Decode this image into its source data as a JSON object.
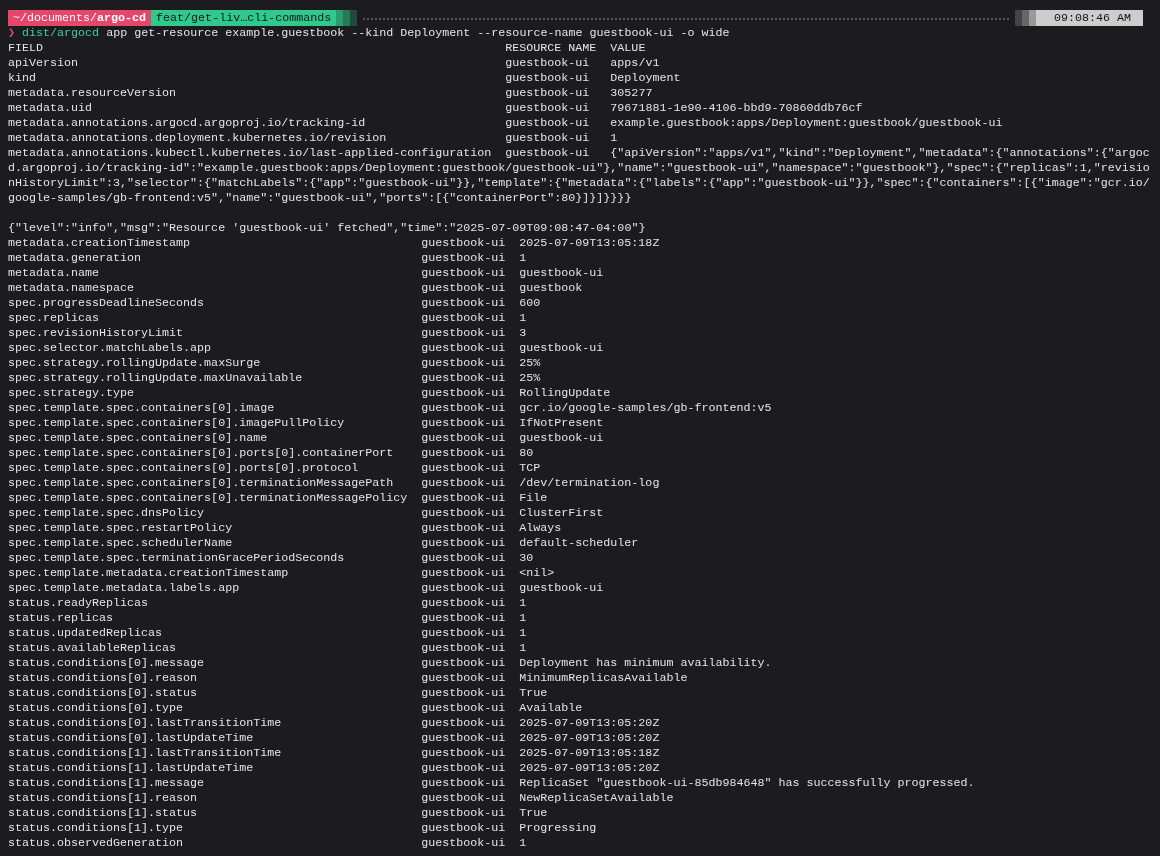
{
  "status_line": {
    "path": "~/documents/**argo-cd**",
    "branch": "feat/get-liv…cli-commands",
    "time": "09:08:46 AM"
  },
  "command": {
    "prompt": "❯",
    "program": "dist/argocd",
    "args": "app get-resource example.guestbook --kind Deployment --resource-name guestbook-ui -o wide"
  },
  "table_1": {
    "columns": [
      "FIELD",
      "RESOURCE NAME",
      "VALUE"
    ],
    "rows": [
      {
        "field": "apiVersion",
        "resource": "guestbook-ui",
        "value": "apps/v1"
      },
      {
        "field": "kind",
        "resource": "guestbook-ui",
        "value": "Deployment"
      },
      {
        "field": "metadata.resourceVersion",
        "resource": "guestbook-ui",
        "value": "305277"
      },
      {
        "field": "metadata.uid",
        "resource": "guestbook-ui",
        "value": "79671881-1e90-4106-bbd9-70860ddb76cf"
      },
      {
        "field": "metadata.annotations.argocd.argoproj.io/tracking-id",
        "resource": "guestbook-ui",
        "value": "example.guestbook:apps/Deployment:guestbook/guestbook-ui"
      },
      {
        "field": "metadata.annotations.deployment.kubernetes.io/revision",
        "resource": "guestbook-ui",
        "value": "1"
      },
      {
        "field": "metadata.annotations.kubectl.kubernetes.io/last-applied-configuration",
        "resource": "guestbook-ui",
        "value": "{\"apiVersion\":\"apps/v1\",\"kind\":\"Deployment\",\"metadata\":{\"annotations\":{\"argocd.argoproj.io/tracking-id\":\"example.guestbook:apps/Deployment:guestbook/guestbook-ui\"},\"name\":\"guestbook-ui\",\"namespace\":\"guestbook\"},\"spec\":{\"replicas\":1,\"revisionHistoryLimit\":3,\"selector\":{\"matchLabels\":{\"app\":\"guestbook-ui\"}},\"template\":{\"metadata\":{\"labels\":{\"app\":\"guestbook-ui\"}},\"spec\":{\"containers\":[{\"image\":\"gcr.io/google-samples/gb-frontend:v5\",\"name\":\"guestbook-ui\",\"ports\":[{\"containerPort\":80}]}]}}}}"
      }
    ]
  },
  "log": "{\"level\":\"info\",\"msg\":\"Resource 'guestbook-ui' fetched\",\"time\":\"2025-07-09T09:08:47-04:00\"}",
  "table_2": {
    "rows": [
      {
        "field": "metadata.creationTimestamp",
        "resource": "guestbook-ui",
        "value": "2025-07-09T13:05:18Z"
      },
      {
        "field": "metadata.generation",
        "resource": "guestbook-ui",
        "value": "1"
      },
      {
        "field": "metadata.name",
        "resource": "guestbook-ui",
        "value": "guestbook-ui"
      },
      {
        "field": "metadata.namespace",
        "resource": "guestbook-ui",
        "value": "guestbook"
      },
      {
        "field": "spec.progressDeadlineSeconds",
        "resource": "guestbook-ui",
        "value": "600"
      },
      {
        "field": "spec.replicas",
        "resource": "guestbook-ui",
        "value": "1"
      },
      {
        "field": "spec.revisionHistoryLimit",
        "resource": "guestbook-ui",
        "value": "3"
      },
      {
        "field": "spec.selector.matchLabels.app",
        "resource": "guestbook-ui",
        "value": "guestbook-ui"
      },
      {
        "field": "spec.strategy.rollingUpdate.maxSurge",
        "resource": "guestbook-ui",
        "value": "25%"
      },
      {
        "field": "spec.strategy.rollingUpdate.maxUnavailable",
        "resource": "guestbook-ui",
        "value": "25%"
      },
      {
        "field": "spec.strategy.type",
        "resource": "guestbook-ui",
        "value": "RollingUpdate"
      },
      {
        "field": "spec.template.spec.containers[0].image",
        "resource": "guestbook-ui",
        "value": "gcr.io/google-samples/gb-frontend:v5"
      },
      {
        "field": "spec.template.spec.containers[0].imagePullPolicy",
        "resource": "guestbook-ui",
        "value": "IfNotPresent"
      },
      {
        "field": "spec.template.spec.containers[0].name",
        "resource": "guestbook-ui",
        "value": "guestbook-ui"
      },
      {
        "field": "spec.template.spec.containers[0].ports[0].containerPort",
        "resource": "guestbook-ui",
        "value": "80"
      },
      {
        "field": "spec.template.spec.containers[0].ports[0].protocol",
        "resource": "guestbook-ui",
        "value": "TCP"
      },
      {
        "field": "spec.template.spec.containers[0].terminationMessagePath",
        "resource": "guestbook-ui",
        "value": "/dev/termination-log"
      },
      {
        "field": "spec.template.spec.containers[0].terminationMessagePolicy",
        "resource": "guestbook-ui",
        "value": "File"
      },
      {
        "field": "spec.template.spec.dnsPolicy",
        "resource": "guestbook-ui",
        "value": "ClusterFirst"
      },
      {
        "field": "spec.template.spec.restartPolicy",
        "resource": "guestbook-ui",
        "value": "Always"
      },
      {
        "field": "spec.template.spec.schedulerName",
        "resource": "guestbook-ui",
        "value": "default-scheduler"
      },
      {
        "field": "spec.template.spec.terminationGracePeriodSeconds",
        "resource": "guestbook-ui",
        "value": "30"
      },
      {
        "field": "spec.template.metadata.creationTimestamp",
        "resource": "guestbook-ui",
        "value": "<nil>"
      },
      {
        "field": "spec.template.metadata.labels.app",
        "resource": "guestbook-ui",
        "value": "guestbook-ui"
      },
      {
        "field": "status.readyReplicas",
        "resource": "guestbook-ui",
        "value": "1"
      },
      {
        "field": "status.replicas",
        "resource": "guestbook-ui",
        "value": "1"
      },
      {
        "field": "status.updatedReplicas",
        "resource": "guestbook-ui",
        "value": "1"
      },
      {
        "field": "status.availableReplicas",
        "resource": "guestbook-ui",
        "value": "1"
      },
      {
        "field": "status.conditions[0].message",
        "resource": "guestbook-ui",
        "value": "Deployment has minimum availability."
      },
      {
        "field": "status.conditions[0].reason",
        "resource": "guestbook-ui",
        "value": "MinimumReplicasAvailable"
      },
      {
        "field": "status.conditions[0].status",
        "resource": "guestbook-ui",
        "value": "True"
      },
      {
        "field": "status.conditions[0].type",
        "resource": "guestbook-ui",
        "value": "Available"
      },
      {
        "field": "status.conditions[0].lastTransitionTime",
        "resource": "guestbook-ui",
        "value": "2025-07-09T13:05:20Z"
      },
      {
        "field": "status.conditions[0].lastUpdateTime",
        "resource": "guestbook-ui",
        "value": "2025-07-09T13:05:20Z"
      },
      {
        "field": "status.conditions[1].lastTransitionTime",
        "resource": "guestbook-ui",
        "value": "2025-07-09T13:05:18Z"
      },
      {
        "field": "status.conditions[1].lastUpdateTime",
        "resource": "guestbook-ui",
        "value": "2025-07-09T13:05:20Z"
      },
      {
        "field": "status.conditions[1].message",
        "resource": "guestbook-ui",
        "value": "ReplicaSet \"guestbook-ui-85db984648\" has successfully progressed."
      },
      {
        "field": "status.conditions[1].reason",
        "resource": "guestbook-ui",
        "value": "NewReplicaSetAvailable"
      },
      {
        "field": "status.conditions[1].status",
        "resource": "guestbook-ui",
        "value": "True"
      },
      {
        "field": "status.conditions[1].type",
        "resource": "guestbook-ui",
        "value": "Progressing"
      },
      {
        "field": "status.observedGeneration",
        "resource": "guestbook-ui",
        "value": "1"
      }
    ]
  }
}
